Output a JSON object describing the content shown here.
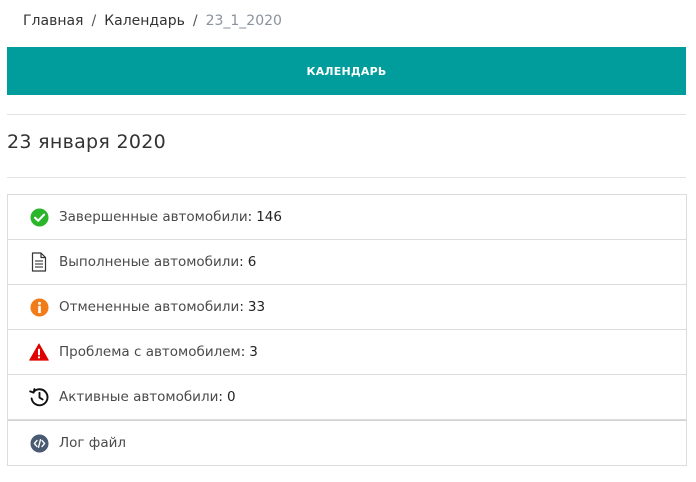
{
  "breadcrumb": {
    "home": "Главная",
    "calendar": "Календарь",
    "current": "23_1_2020",
    "separator": "/"
  },
  "calendar_button": {
    "label": "КАЛЕНДАРЬ",
    "color": "#019c9c"
  },
  "page": {
    "title": "23 января 2020"
  },
  "stats": [
    {
      "label": "Завершенные автомобили",
      "count": "146",
      "icon": "check-circle-icon",
      "icon_color": "#2ab52a"
    },
    {
      "label": "Выполненые автомобили",
      "count": "6",
      "icon": "document-icon",
      "icon_color": "#333333"
    },
    {
      "label": "Отмененные автомобили",
      "count": "33",
      "icon": "info-circle-icon",
      "icon_color": "#f27c18"
    },
    {
      "label": "Проблема с автомобилем",
      "count": "3",
      "icon": "warning-triangle-icon",
      "icon_color": "#e00000"
    },
    {
      "label": "Активные автомобили",
      "count": "0",
      "icon": "history-icon",
      "icon_color": "#111111"
    }
  ],
  "log": {
    "label": "Лог файл",
    "icon": "code-icon",
    "icon_color": "#4a5a72"
  }
}
